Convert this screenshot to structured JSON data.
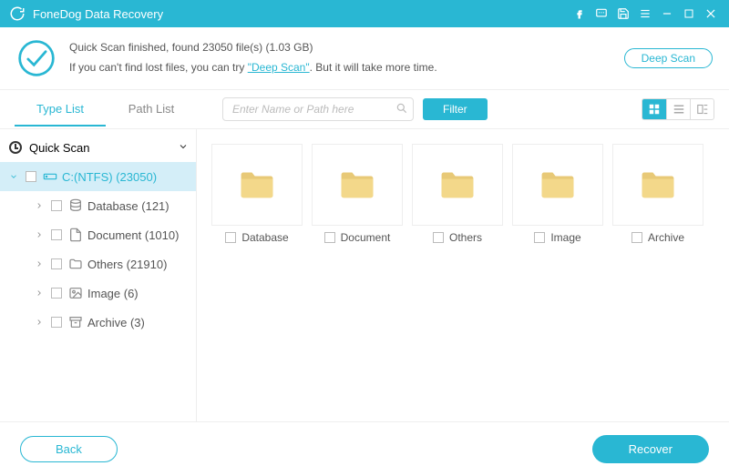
{
  "app_title": "FoneDog Data Recovery",
  "status": {
    "line1_a": "Quick Scan finished, found ",
    "file_count": "23050",
    "line1_b": " file(s) (",
    "size": "1.03 GB",
    "line1_c": ")",
    "line2_a": "If you can't find lost files, you can try ",
    "deep_link": "\"Deep Scan\"",
    "line2_b": ". But it will take more time.",
    "deep_scan_btn": "Deep Scan"
  },
  "tabs": {
    "type_list": "Type List",
    "path_list": "Path List"
  },
  "search": {
    "placeholder": "Enter Name or Path here"
  },
  "filter_btn": "Filter",
  "tree": {
    "quick_scan": "Quick Scan",
    "drive": "C:(NTFS) (23050)",
    "items": [
      {
        "label": "Database (121)"
      },
      {
        "label": "Document (1010)"
      },
      {
        "label": "Others (21910)"
      },
      {
        "label": "Image (6)"
      },
      {
        "label": "Archive (3)"
      }
    ]
  },
  "folders": [
    {
      "label": "Database"
    },
    {
      "label": "Document"
    },
    {
      "label": "Others"
    },
    {
      "label": "Image"
    },
    {
      "label": "Archive"
    }
  ],
  "footer": {
    "back": "Back",
    "recover": "Recover"
  }
}
